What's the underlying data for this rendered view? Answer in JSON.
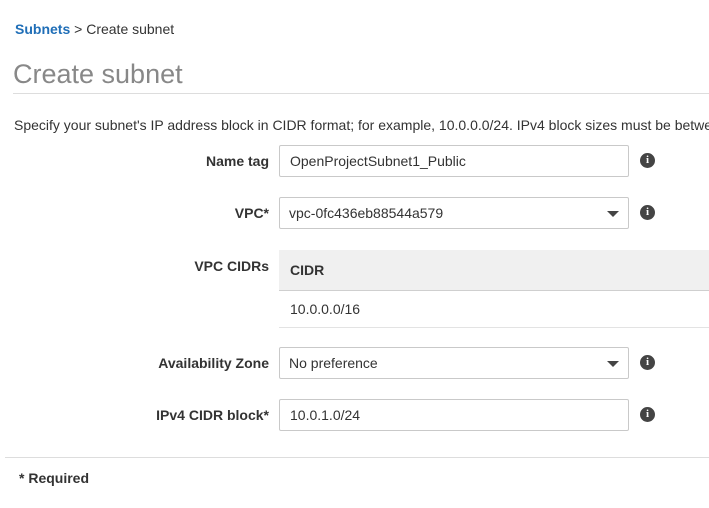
{
  "breadcrumb": {
    "parent": "Subnets",
    "separator": " > ",
    "current": "Create subnet"
  },
  "page": {
    "title": "Create subnet",
    "description": "Specify your subnet's IP address block in CIDR format; for example, 10.0.0.0/24. IPv4 block sizes must be betwe"
  },
  "form": {
    "name_tag": {
      "label": "Name tag",
      "value": "OpenProjectSubnet1_Public"
    },
    "vpc": {
      "label": "VPC*",
      "value": "vpc-0fc436eb88544a579"
    },
    "vpc_cidrs": {
      "label": "VPC CIDRs",
      "column": "CIDR",
      "rows": [
        "10.0.0.0/16"
      ]
    },
    "availability_zone": {
      "label": "Availability Zone",
      "value": "No preference"
    },
    "ipv4_cidr": {
      "label": "IPv4 CIDR block*",
      "value": "10.0.1.0/24"
    }
  },
  "footer": {
    "required_note": "* Required"
  },
  "info_glyph": "i",
  "colors": {
    "link": "#1f6eb7",
    "title": "#888888",
    "table_header": "#f0f0f0"
  },
  "icons": {
    "info": "info-icon",
    "dropdown": "caret-down-icon"
  }
}
